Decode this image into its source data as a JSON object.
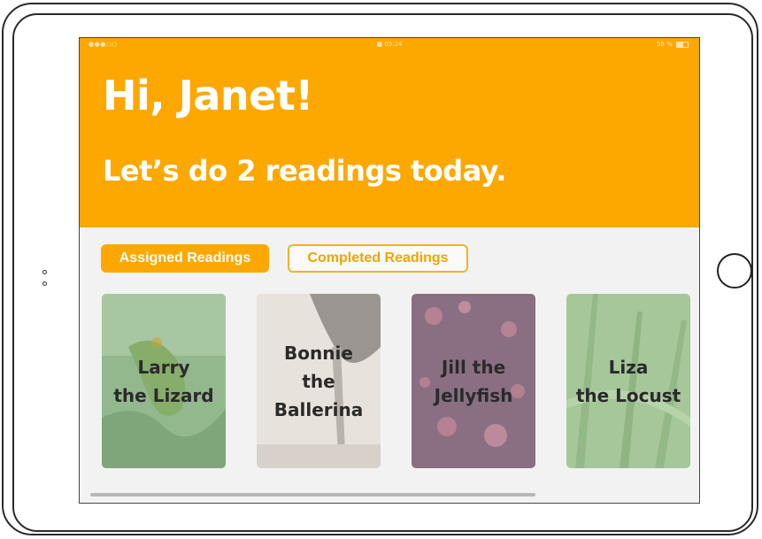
{
  "status_bar": {
    "signal": "●●●○○",
    "time": "09:24",
    "battery": "58 %",
    "battery_level": 0.58
  },
  "header": {
    "greeting": "Hi, Janet!",
    "subtitle": "Let’s do 2 readings today.",
    "background_color": "#fca800"
  },
  "tabs": [
    {
      "label": "Assigned Readings",
      "active": true
    },
    {
      "label": "Completed Readings",
      "active": false
    }
  ],
  "readings": [
    {
      "title": "Larry\nthe Lizard",
      "image": "lizard-photo"
    },
    {
      "title": "Bonnie\nthe\nBallerina",
      "image": "ballerina-photo"
    },
    {
      "title": "Jill the\nJellyfish",
      "image": "jellyfish-photo"
    },
    {
      "title": "Liza\nthe Locust",
      "image": "grass-photo"
    }
  ],
  "colors": {
    "accent": "#fca800",
    "card_text": "#2a2a2a",
    "screen_background": "#f2f2f2"
  }
}
